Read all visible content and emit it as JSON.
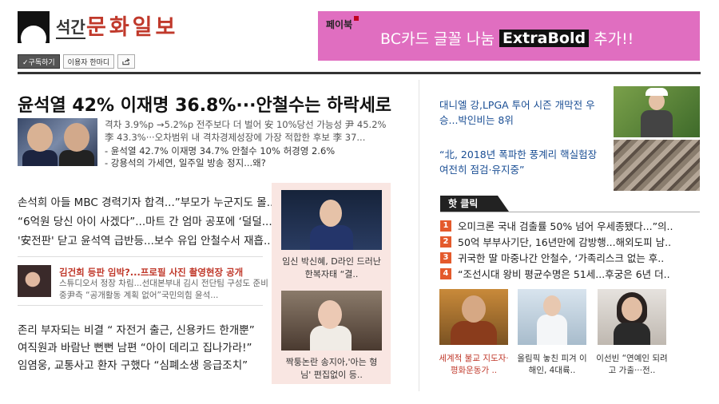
{
  "header": {
    "logo_small": "석간",
    "logo_main": "문화일보",
    "subscribe_label": "✓구독하기",
    "user_guide_label": "이용자 한마디"
  },
  "ad": {
    "tag": "페이북",
    "text_before": "BC카드 글꼴 나눔",
    "text_highlight": "ExtraBold",
    "text_after": "추가!!"
  },
  "main_article": {
    "headline": "윤석열 42% 이재명 36.8%···안철수는 하락세로",
    "desc": "격차 3.9%p →5.2%p 전주보다 더 벌어 安 10%당선 가능성 尹 45.2% 李 43.3%···오차범위 내 격차경제성장에 가장 적합한 후보 李 37...",
    "bullets": [
      "- 윤석열 42.7% 이재명 34.7% 안철수 10% 허경영 2.6%",
      "- 강용석의 가세연, 일주일 방송 정지...왜?"
    ]
  },
  "list1": [
    "손석희 아들 MBC 경력기자 합격...”부모가 누군지도 몰..",
    "“6억원 당신 아이 사겠다”...마트 간 엄마 공포에 ‘덜덜...",
    "'安전판' 닫고 윤석역 급반등...보수 유입 안철수서 재흡.."
  ],
  "sub_article": {
    "title": "김건희 등판 임박?...프로필 사진 촬영현장 공개",
    "desc": "스튜디오서 정장 차림...선대본부내 김시 전단팀 구성도 준비 중尹측 “공개활동 계획 없어”국민의힘 윤석..."
  },
  "list2": [
    "존리 부자되는 비결 “ 자전거 출근, 신용카드 한개뿐”",
    "여직원과 바람난 뻔뻔 남편 “아이 데리고 집나가라!”",
    "임염웅, 교통사고 환자 구했다 “심폐소생 응급조치”"
  ],
  "photo_box": [
    {
      "caption": "임신 박신혜, D라인 드러난 한복자태 “결.."
    },
    {
      "caption": "짝퉁논란 송지아,'아는 형님' 편집없이 등.."
    }
  ],
  "right_news": [
    "대니엘 강,LPGA 투어 시즌 개막전 우승...박인비는 8위",
    "“北, 2018년 폭파한 풍계리 핵실험장 여전히 점검·유지중”"
  ],
  "hot_click": {
    "tab_label": "핫 클릭",
    "items": [
      {
        "num": "1",
        "text": "오미크론 국내 검출률 50% 넘어 우세종됐다...”의.."
      },
      {
        "num": "2",
        "text": "50억 부부사기단, 16년만에 감방행...해외도피 남.."
      },
      {
        "num": "3",
        "text": "귀국한 딸 마중나간 안철수, ‘가족리스크 없는 후.."
      },
      {
        "num": "4",
        "text": "“조선시대 왕비 평균수명은 51세...후궁은 6년 더.."
      }
    ]
  },
  "thumbs": [
    {
      "caption": "세계적 불교 지도자·평화운동가 ..",
      "accent": "#c0392b"
    },
    {
      "caption": "올림픽 놓친 피겨 이해인, 4대륙.."
    },
    {
      "caption": "이선빈 “연예인 되려고 가출···전.."
    }
  ],
  "colors": {
    "accent": "#c0392b",
    "ad_bg": "#e06ec0",
    "link": "#1a4e94",
    "hot_num": "#e45a2c"
  }
}
